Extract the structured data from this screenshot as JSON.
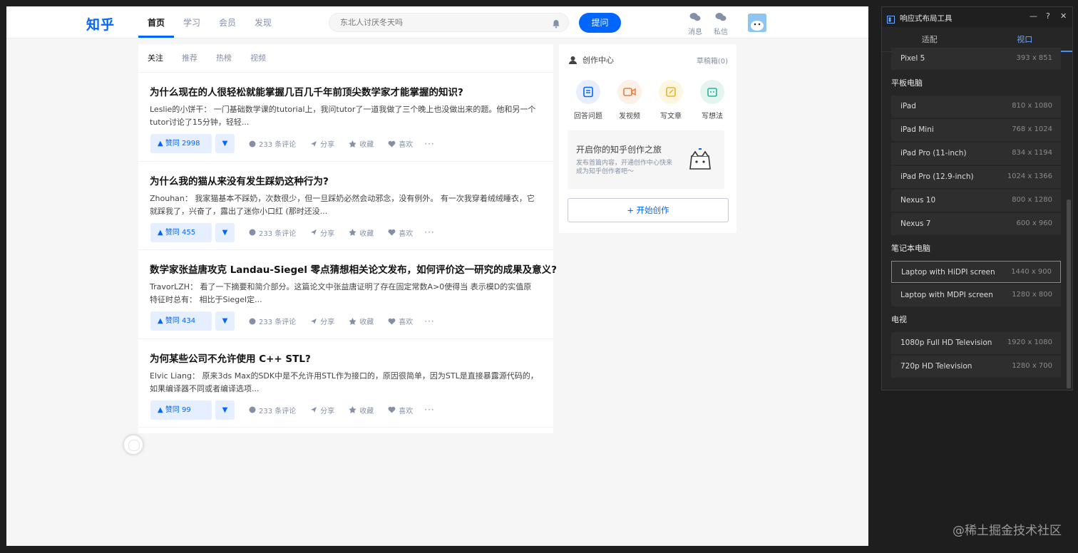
{
  "zhihu": {
    "logo": "知乎",
    "nav": [
      "首页",
      "学习",
      "会员",
      "发现"
    ],
    "search_placeholder": "东北人讨厌冬天吗",
    "ask_button": "提问",
    "messages_label": "消息",
    "private_label": "私信",
    "feed_tabs": [
      "关注",
      "推荐",
      "热榜",
      "视频"
    ],
    "items": [
      {
        "title": "为什么现在的人很轻松就能掌握几百几千年前顶尖数学家才能掌握的知识?",
        "excerpt": "Leslie的小饼干： 一门基础数学课的tutorial上，我问tutor了一道我做了三个晚上也没做出来的题。他和另一个tutor讨论了15分钟，轻轻...",
        "vote": "▲ 赞同 2998"
      },
      {
        "title": "为什么我的猫从来没有发生踩奶这种行为?",
        "excerpt": "Zhouhan： 我家猫基本不踩奶，次数很少，但一旦踩奶必然会动邪念，没有例外。 有一次我穿着绒绒睡衣，它就踩我了，兴奋了，露出了迷你小口红 (那时还没...",
        "vote": "▲ 赞同 455"
      },
      {
        "title": "数学家张益唐攻克 Landau-Siegel 零点猜想相关论文发布，如何评价这一研究的成果及意义?",
        "excerpt": "TravorLZH： 看了一下摘要和简介部分。这篇论文中张益唐证明了存在固定常数A>0使得当 表示模D的实值原特征时总有： 相比于Siegel定...",
        "vote": "▲ 赞同 434"
      },
      {
        "title": "为何某些公司不允许使用 C++ STL?",
        "excerpt": "Elvic Liang： 原来3ds Max的SDK中是不允许用STL作为接口的，原因很简单，因为STL是直接暴露源代码的，如果编译器不同或者编译选项...",
        "vote": "▲ 赞同 99"
      }
    ],
    "actions": {
      "comments": "233 条评论",
      "share": "分享",
      "collect": "收藏",
      "like": "喜欢",
      "more": "···",
      "vote_down": "▼"
    },
    "creator": {
      "title": "创作中心",
      "drafts": "草稿箱(0)",
      "tools": [
        "回答问题",
        "发视频",
        "写文章",
        "写想法"
      ],
      "promo_title": "开启你的知乎创作之旅",
      "promo_sub": "发布首篇内容，开通创作中心快来成为知乎创作者吧～",
      "start_button": "+ 开始创作"
    }
  },
  "devtools": {
    "title": "响应式布局工具",
    "controls": [
      "—",
      "?",
      "✕"
    ],
    "tabs": [
      "适配",
      "视口"
    ],
    "active_tab": 1,
    "top_item": {
      "name": "Pixel 5",
      "size": "393 x 851"
    },
    "groups": [
      {
        "label": "平板电脑",
        "items": [
          {
            "name": "iPad",
            "size": "810 x 1080"
          },
          {
            "name": "iPad Mini",
            "size": "768 x 1024"
          },
          {
            "name": "iPad Pro (11-inch)",
            "size": "834 x 1194"
          },
          {
            "name": "iPad Pro (12.9-inch)",
            "size": "1024 x 1366"
          },
          {
            "name": "Nexus 10",
            "size": "800 x 1280"
          },
          {
            "name": "Nexus 7",
            "size": "600 x 960"
          }
        ]
      },
      {
        "label": "笔记本电脑",
        "items": [
          {
            "name": "Laptop with HiDPI screen",
            "size": "1440 x 900",
            "selected": true
          },
          {
            "name": "Laptop with MDPI screen",
            "size": "1280 x 800"
          }
        ]
      },
      {
        "label": "电视",
        "items": [
          {
            "name": "1080p Full HD Television",
            "size": "1920 x 1080"
          },
          {
            "name": "720p HD Television",
            "size": "1280 x 700"
          }
        ]
      }
    ]
  },
  "watermark": "@稀土掘金技术社区",
  "colors": {
    "brand": "#0066ff",
    "vote_bg": "#e5efff",
    "panel_bg": "#262626",
    "accent": "#4a8ff0"
  }
}
